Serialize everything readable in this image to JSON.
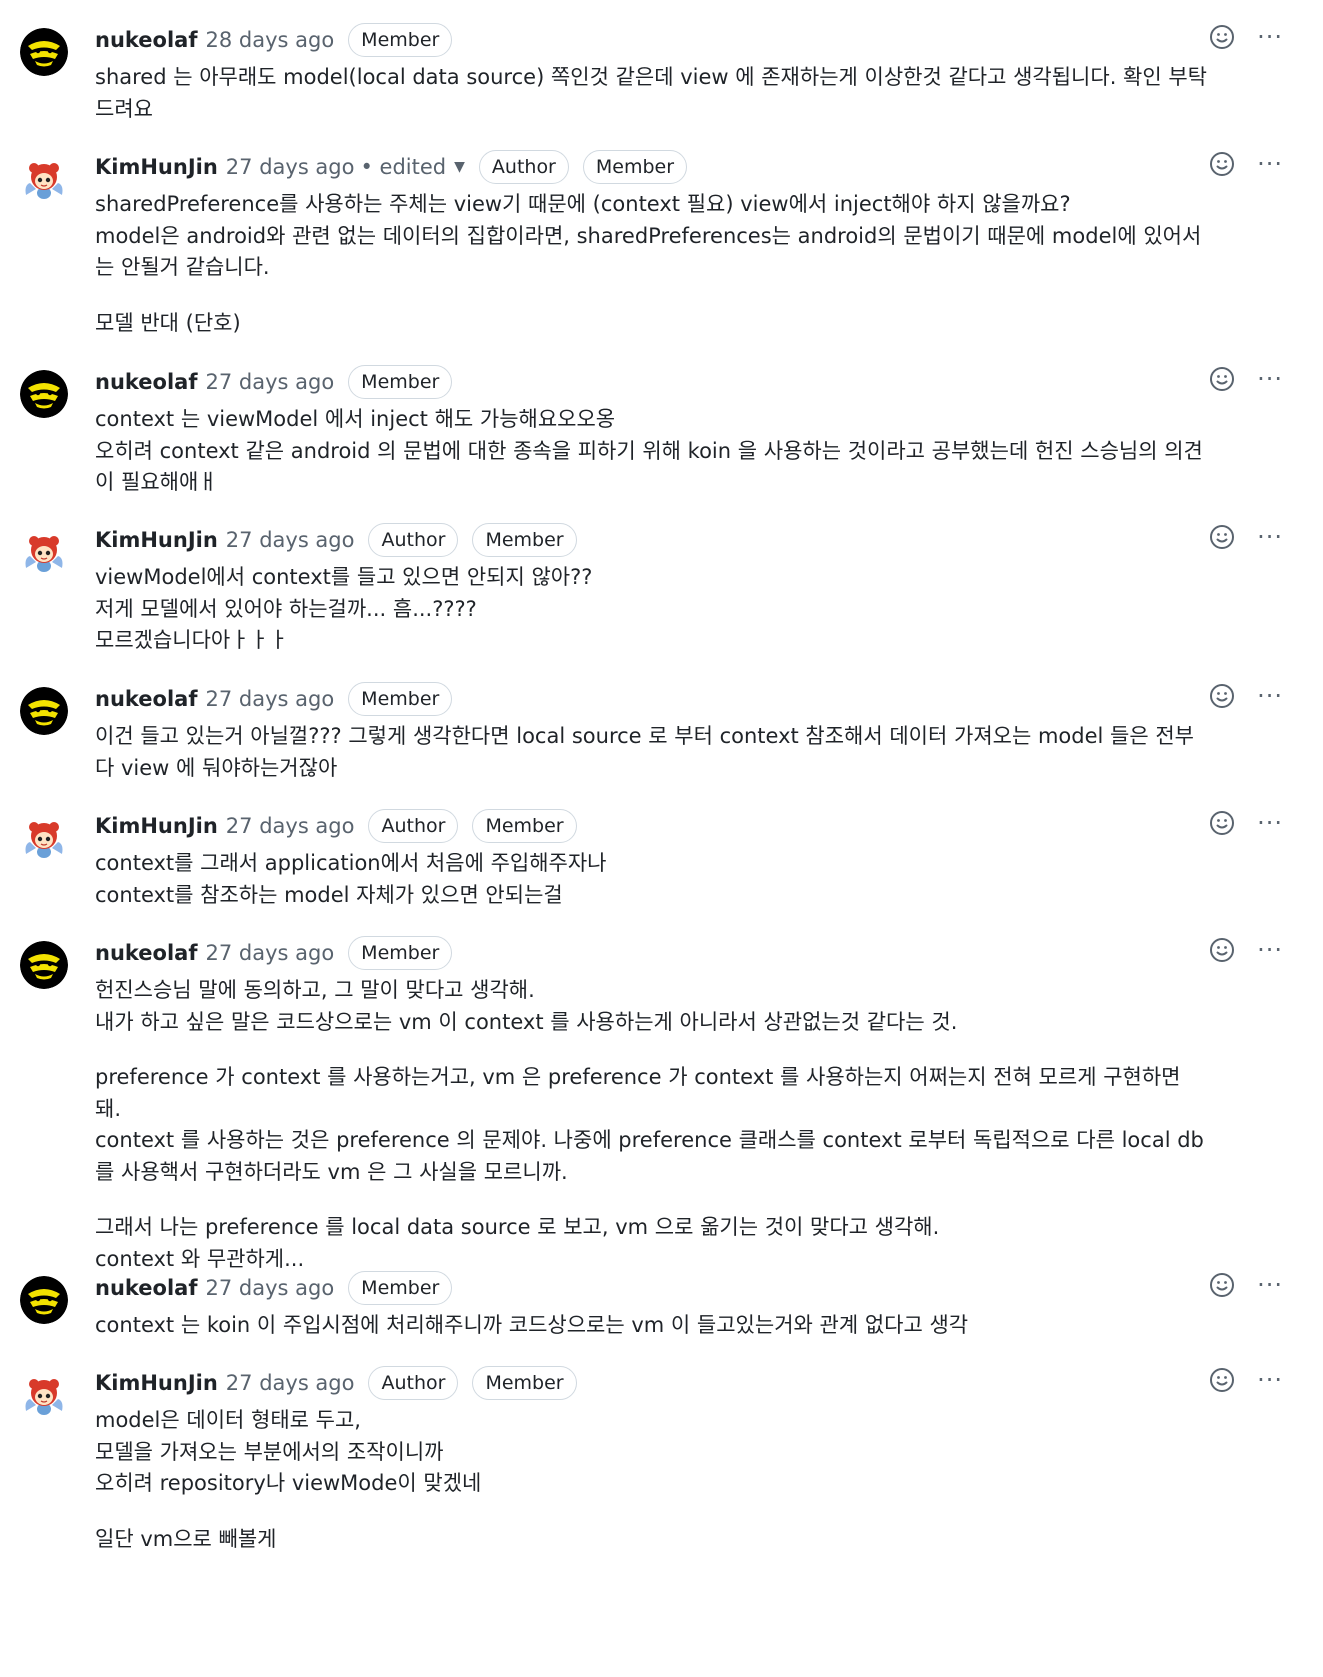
{
  "labels": {
    "member": "Member",
    "author": "Author",
    "edited": "• edited",
    "more": "···"
  },
  "comments": [
    {
      "author": "nukeolaf",
      "time": "28 days ago",
      "badges": [
        "Member"
      ],
      "paragraphs": [
        [
          "shared 는 아무래도 model(local data source) 쪽인것 같은데 view 에 존재하는게 이상한것 같다고 생각됩니다. 확인 부탁드려요"
        ]
      ]
    },
    {
      "author": "KimHunJin",
      "time": "27 days ago",
      "edited": true,
      "badges": [
        "Author",
        "Member"
      ],
      "paragraphs": [
        [
          "sharedPreference를 사용하는 주체는 view기 때문에 (context 필요) view에서 inject해야 하지 않을까요?",
          "model은 android와 관련 없는 데이터의 집합이라면, sharedPreferences는 android의 문법이기 때문에 model에 있어서는 안될거 같습니다."
        ],
        [
          "모델 반대 (단호)"
        ]
      ]
    },
    {
      "author": "nukeolaf",
      "time": "27 days ago",
      "badges": [
        "Member"
      ],
      "paragraphs": [
        [
          "context 는 viewModel 에서 inject 해도 가능해요오오옹",
          "오히려 context 같은 android 의 문법에 대한 종속을 피하기 위해 koin 을 사용하는 것이라고 공부했는데 헌진 스승님의 의견이 필요해애ㅐ"
        ]
      ]
    },
    {
      "author": "KimHunJin",
      "time": "27 days ago",
      "badges": [
        "Author",
        "Member"
      ],
      "paragraphs": [
        [
          "viewModel에서 context를 들고 있으면 안되지 않아??",
          "저게 모델에서 있어야 하는걸까... 흠...????",
          "모르겠습니다아ㅏㅏㅏ"
        ]
      ]
    },
    {
      "author": "nukeolaf",
      "time": "27 days ago",
      "badges": [
        "Member"
      ],
      "paragraphs": [
        [
          "이건 들고 있는거 아닐껄??? 그렇게 생각한다면 local source 로 부터 context 참조해서 데이터 가져오는 model 들은 전부다 view 에 둬야하는거잖아"
        ]
      ]
    },
    {
      "author": "KimHunJin",
      "time": "27 days ago",
      "badges": [
        "Author",
        "Member"
      ],
      "paragraphs": [
        [
          "context를 그래서 application에서 처음에 주입해주자나",
          "context를 참조하는 model 자체가 있으면 안되는걸"
        ]
      ]
    },
    {
      "author": "nukeolaf",
      "time": "27 days ago",
      "badges": [
        "Member"
      ],
      "paragraphs": [
        [
          "헌진스승님 말에 동의하고, 그 말이 맞다고 생각해.",
          "내가 하고 싶은 말은 코드상으로는 vm 이 context 를 사용하는게 아니라서 상관없는것 같다는 것."
        ],
        [
          "preference 가 context 를 사용하는거고, vm 은 preference 가 context 를 사용하는지 어쩌는지 전혀 모르게 구현하면 돼.",
          "context 를 사용하는 것은 preference 의 문제야. 나중에 preference 클래스를 context 로부터 독립적으로 다른 local db 를 사용핵서 구현하더라도 vm 은 그 사실을 모르니까."
        ],
        [
          "그래서 나는 preference 를 local data source 로 보고, vm 으로 옮기는 것이 맞다고 생각해.",
          "context 와 무관하게..."
        ]
      ]
    },
    {
      "author": "nukeolaf",
      "time": "27 days ago",
      "badges": [
        "Member"
      ],
      "paragraphs": [
        [
          "context 는 koin 이 주입시점에 처리해주니까 코드상으로는 vm 이 들고있는거와 관계 없다고 생각"
        ]
      ]
    },
    {
      "author": "KimHunJin",
      "time": "27 days ago",
      "badges": [
        "Author",
        "Member"
      ],
      "paragraphs": [
        [
          "model은 데이터 형태로 두고,",
          "모델을 가져오는 부분에서의 조작이니까",
          "오히려 repository나 viewMode이 맞겠네"
        ],
        [
          "일단 vm으로 빼볼게"
        ]
      ]
    }
  ]
}
